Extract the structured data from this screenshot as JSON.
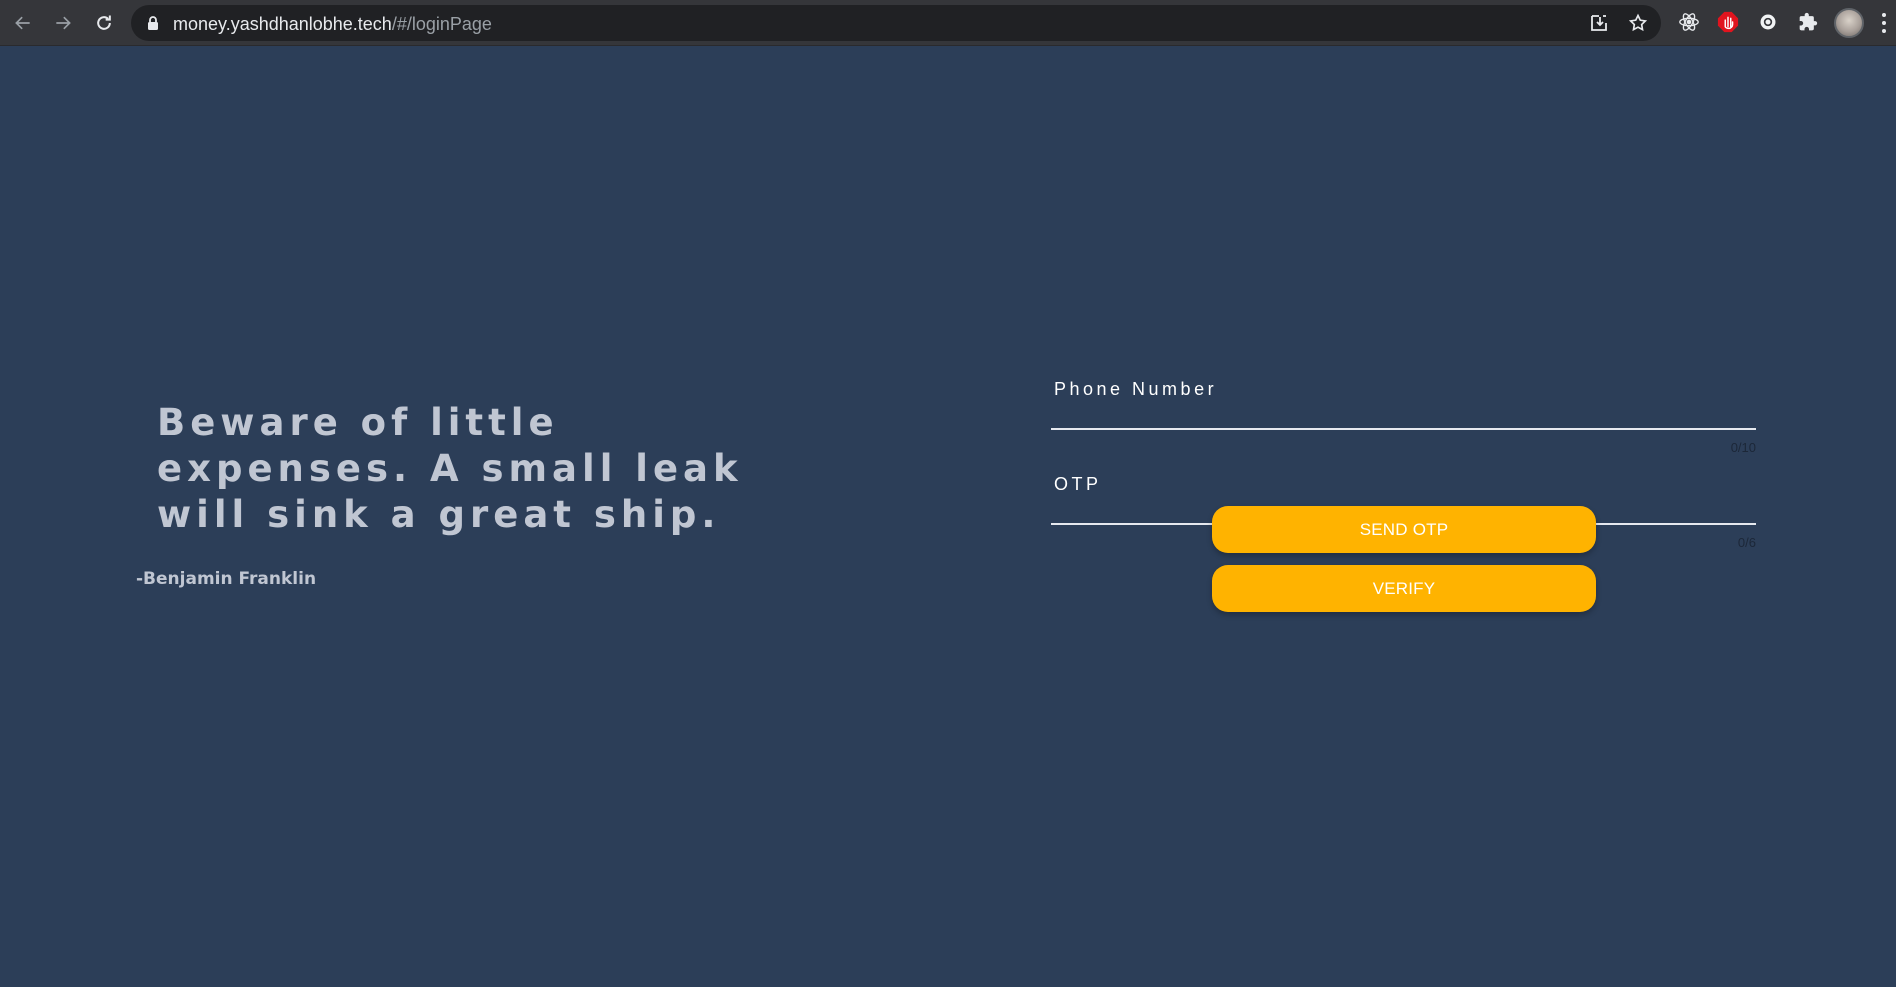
{
  "browser": {
    "url_host": "money.yashdhanlobhe.tech",
    "url_path": "/#/loginPage",
    "icons": {
      "back": "arrow-left-icon",
      "forward": "arrow-right-icon",
      "reload": "reload-icon",
      "lock": "lock-icon",
      "install": "install-icon",
      "bookmark": "star-icon",
      "react_devtools": "react-icon",
      "adblock": "stop-hand-icon",
      "extension_circle": "circle-extension-icon",
      "extensions": "puzzle-icon",
      "menu": "more-vertical-icon"
    }
  },
  "quote": {
    "text": "Beware of little expenses. A small leak will sink a great ship.",
    "author": "-Benjamin Franklin"
  },
  "form": {
    "phone": {
      "label": "Phone Number",
      "value": "",
      "counter": "0/10"
    },
    "otp": {
      "label": "OTP",
      "value": "",
      "counter": "0/6"
    },
    "send_otp_label": "SEND OTP",
    "verify_label": "VERIFY"
  },
  "colors": {
    "background": "#2c3e58",
    "accent": "#ffb300",
    "quote_text": "#c0c6d2"
  }
}
